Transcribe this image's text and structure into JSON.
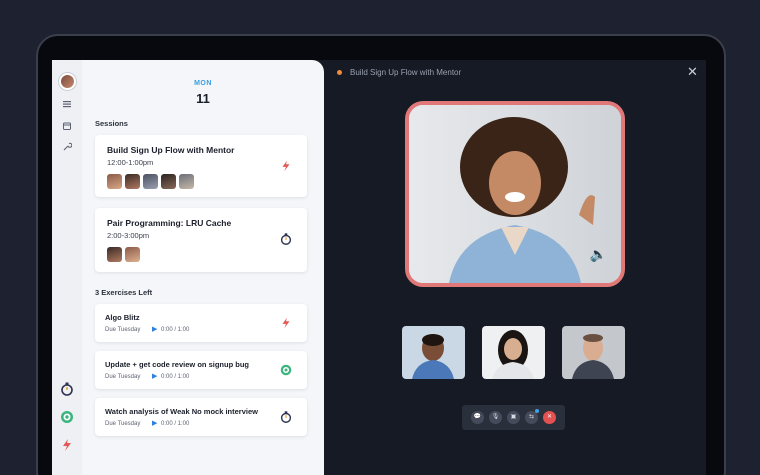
{
  "calendar": {
    "day_name": "MON",
    "day_number": "11"
  },
  "sessions": {
    "label": "Sessions",
    "items": [
      {
        "title": "Build Sign Up Flow with Mentor",
        "time": "12:00-1:00pm",
        "icon": "fast-icon"
      },
      {
        "title": "Pair Programming: LRU Cache",
        "time": "2:00-3:00pm",
        "icon": "timer-icon"
      }
    ]
  },
  "exercises": {
    "label": "3 Exercises Left",
    "items": [
      {
        "title": "Algo Blitz",
        "due": "Due Tuesday",
        "progress": "0:00 / 1:00",
        "icon": "fast-icon"
      },
      {
        "title": "Update + get code review on signup bug",
        "due": "Due Tuesday",
        "progress": "0:00 / 1:00",
        "icon": "target-icon"
      },
      {
        "title": "Watch analysis of Weak No mock interview",
        "due": "Due Tuesday",
        "progress": "0:00 / 1:00",
        "icon": "timer-icon"
      }
    ]
  },
  "call": {
    "title": "Build Sign Up Flow with Mentor",
    "close_glyph": "✕"
  },
  "toolbar": {
    "chat": "💬",
    "mic": "🎙",
    "camera": "▣",
    "share": "⇆",
    "end": "✕"
  },
  "colors": {
    "accent_blue": "#3a9ee0",
    "main_video_border": "#e07878",
    "end_call": "#e45151",
    "status_dot": "#f08a3c"
  }
}
